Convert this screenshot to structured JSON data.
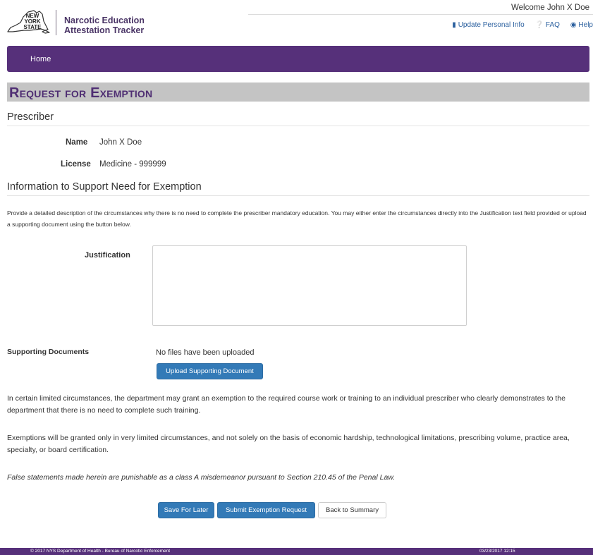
{
  "colors": {
    "brand_purple": "#56307a",
    "title_purple": "#4f2e73",
    "primary_blue": "#337ab7",
    "link_blue": "#2a5f9e",
    "title_bar_grey": "#c4c4c4"
  },
  "header": {
    "logo": {
      "icon": "ny-state-outline-icon",
      "line1": "NEW",
      "line2": "YORK",
      "line3": "STATE"
    },
    "app_title_line1": "Narcotic Education",
    "app_title_line2": "Attestation Tracker",
    "welcome": "Welcome John X Doe",
    "links": [
      {
        "icon": "book-icon",
        "label": "Update Personal Info"
      },
      {
        "icon": "question-circle-icon",
        "label": "FAQ"
      },
      {
        "icon": "lifebuoy-icon",
        "label": "Help"
      }
    ]
  },
  "nav": {
    "home_label": "Home"
  },
  "page_title": "Request for Exemption",
  "prescriber": {
    "heading": "Prescriber",
    "name_label": "Name",
    "name_value": "John X Doe",
    "license_label": "License",
    "license_value": "Medicine - 999999"
  },
  "info": {
    "heading": "Information to Support Need for Exemption",
    "description": "Provide a detailed description of the circumstances why there is no need to complete the prescriber mandatory education. You may either enter the circumstances directly into the Justification text field provided or upload a supporting document using the button below.",
    "justification_label": "Justification",
    "justification_value": "",
    "supporting_docs_label": "Supporting Documents",
    "no_files": "No files have been uploaded",
    "upload_button": "Upload Supporting Document"
  },
  "notes": {
    "p1": "In certain limited circumstances, the department may grant an exemption to the required course work or training to an individual prescriber who clearly demonstrates to the department that there is no need to complete such training.",
    "p2": "Exemptions will be granted only in very limited circumstances, and not solely on the basis of economic hardship, technological limitations, prescribing volume, practice area, specialty, or board certification.",
    "p3": "False statements made herein are punishable as a class A misdemeanor pursuant to Section 210.45 of the Penal Law."
  },
  "actions": {
    "save": "Save For Later",
    "submit": "Submit Exemption Request",
    "back": "Back to Summary"
  },
  "footer": {
    "copyright": "© 2017 NYS Department of Health - Bureau of Narcotic Enforcement",
    "timestamp": "03/23/2017 12:15"
  }
}
